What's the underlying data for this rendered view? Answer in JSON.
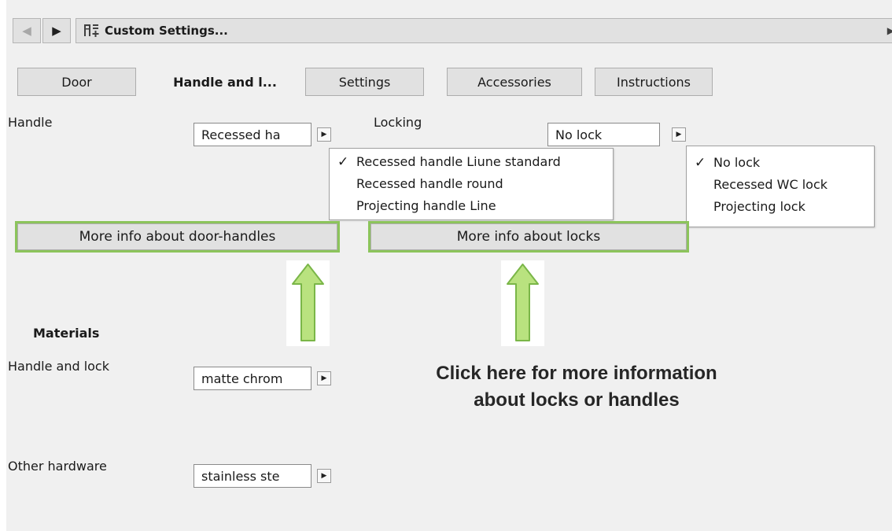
{
  "nav": {
    "back_icon": "back-arrow-icon",
    "forward_icon": "forward-arrow-icon",
    "title": "Custom Settings...",
    "title_icon": "custom-settings-icon"
  },
  "tabs": [
    {
      "label": "Door",
      "active": false
    },
    {
      "label": "Handle and l...",
      "active": true
    },
    {
      "label": "Settings",
      "active": false
    },
    {
      "label": "Accessories",
      "active": false
    },
    {
      "label": "Instructions",
      "active": false
    }
  ],
  "handle": {
    "label": "Handle",
    "value": "Recessed ha",
    "options": [
      "Recessed handle Liune standard",
      "Recessed handle round",
      "Projecting handle Line"
    ],
    "selected_index": 0
  },
  "locking": {
    "label": "Locking",
    "value": "No lock",
    "options": [
      "No lock",
      "Recessed WC lock",
      "Projecting lock"
    ],
    "selected_index": 0
  },
  "buttons": {
    "handles_info": "More info about door-handles",
    "locks_info": "More info about locks"
  },
  "materials": {
    "heading": "Materials",
    "handle_and_lock": {
      "label": "Handle and lock",
      "value": "matte chrom"
    },
    "other_hardware": {
      "label": "Other hardware",
      "value": "stainless ste"
    }
  },
  "callout": {
    "line1": "Click here for more information",
    "line2": "about locks or handles"
  },
  "colors": {
    "highlight": "#8cc45b",
    "arrow_fill": "#b9e27f",
    "arrow_stroke": "#7ab648",
    "panel_bg": "#f0f0f0",
    "button_bg": "#e1e1e1"
  }
}
